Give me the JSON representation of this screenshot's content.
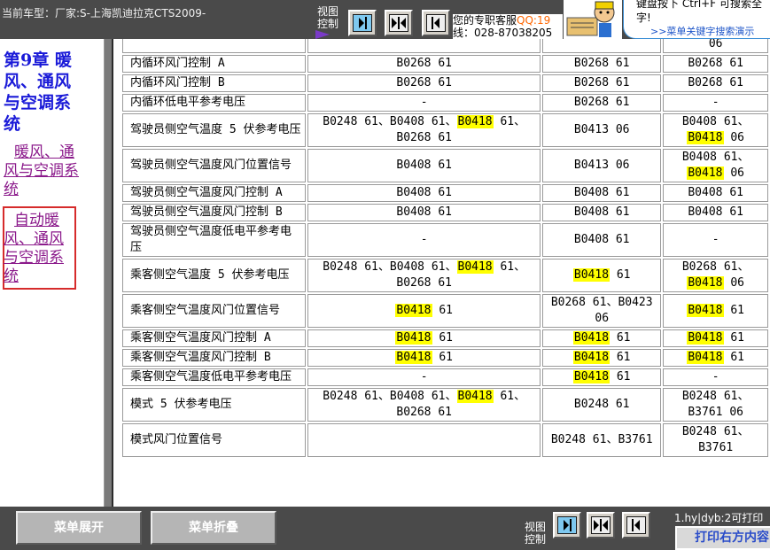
{
  "header": {
    "vehicle_text": "当前车型：厂家:S-上海凯迪拉克CTS2009-",
    "view_label": "视图控制",
    "support_line1": "您的专职客服",
    "support_qq": "QQ:19",
    "support_line2": "线：028-87038205",
    "tip_line1": "键盘按下 Ctrl+F 可搜索全",
    "tip_line2": "字!",
    "tip_link": ">>菜单关键字搜索演示"
  },
  "sidebar": {
    "chapter_title": "第9章 暖风、通风与空调系统",
    "section_link_indent": "暖风、通",
    "section_link_rest": "风与空调系统",
    "current_link_indent": "自动暖",
    "current_link_rest": "风、通风与空调系统"
  },
  "table": {
    "partial_top_c3": "06",
    "rows": [
      {
        "name": "内循环风门控制 A",
        "c1": "B0268 61",
        "c2": "B0268 61",
        "c3": "B0268 61"
      },
      {
        "name": "内循环风门控制 B",
        "c1": "B0268 61",
        "c2": "B0268 61",
        "c3": "B0268 61"
      },
      {
        "name": "内循环低电平参考电压",
        "c1": "-",
        "c2": "B0268 61",
        "c3": "-"
      },
      {
        "name": "驾驶员侧空气温度 5 伏参考电压",
        "c1": "B0248 61、B0408 61、B0418 61、B0268 61",
        "c2": "B0413 06",
        "c3": "B0408 61、B0418 06"
      },
      {
        "name": "驾驶员侧空气温度风门位置信号",
        "c1": "B0408 61",
        "c2": "B0413 06",
        "c3": "B0408 61、B0418 06"
      },
      {
        "name": "驾驶员侧空气温度风门控制 A",
        "c1": "B0408 61",
        "c2": "B0408 61",
        "c3": "B0408 61"
      },
      {
        "name": "驾驶员侧空气温度风门控制 B",
        "c1": "B0408 61",
        "c2": "B0408 61",
        "c3": "B0408 61"
      },
      {
        "name": "驾驶员侧空气温度低电平参考电压",
        "c1": "-",
        "c2": "B0408 61",
        "c3": "-"
      },
      {
        "name": "乘客侧空气温度 5 伏参考电压",
        "c1": "B0248 61、B0408 61、B0418 61、B0268 61",
        "c2": "B0418 61",
        "c3": "B0268 61、B0418 06"
      },
      {
        "name": "乘客侧空气温度风门位置信号",
        "c1": "B0418 61",
        "c2": "B0268 61、B0423 06",
        "c3": "B0418 61"
      },
      {
        "name": "乘客侧空气温度风门控制 A",
        "c1": "B0418 61",
        "c2": "B0418 61",
        "c3": "B0418 61"
      },
      {
        "name": "乘客侧空气温度风门控制 B",
        "c1": "B0418 61",
        "c2": "B0418 61",
        "c3": "B0418 61"
      },
      {
        "name": "乘客侧空气温度低电平参考电压",
        "c1": "-",
        "c2": "B0418 61",
        "c3": "-"
      },
      {
        "name": "模式 5 伏参考电压",
        "c1": "B0248 61、B0408 61、B0418 61、B0268 61",
        "c2": "B0248 61",
        "c3": "B0248 61、B3761 06"
      },
      {
        "name": "模式风门位置信号",
        "c1": "",
        "c2": "B0248 61、B3761",
        "c3": "B0248 61、B3761"
      }
    ],
    "highlight_code": "B0418",
    "highlight_color": "#ffff00"
  },
  "footer": {
    "expand_label": "菜单展开",
    "collapse_label": "菜单折叠",
    "view_label": "视图控制",
    "print_hint": "1.hy|dyb:2可打印",
    "print_label": "打印右方内容"
  },
  "icons": {
    "view_buttons": [
      "dock-left-icon",
      "split-view-icon",
      "dock-right-icon"
    ]
  }
}
